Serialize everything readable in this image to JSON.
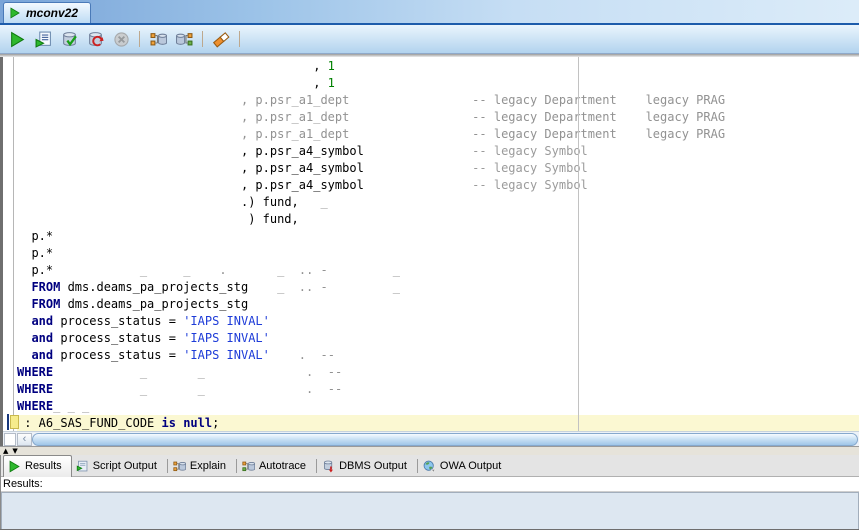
{
  "doc_tab": {
    "label": "mconv22",
    "icon": "run-icon"
  },
  "toolbar": {
    "items": [
      {
        "name": "run-button",
        "icon": "run-icon"
      },
      {
        "name": "run-script-button",
        "icon": "run-script-icon"
      },
      {
        "name": "commit-button",
        "icon": "commit-icon"
      },
      {
        "name": "rollback-button",
        "icon": "rollback-icon"
      },
      {
        "name": "cancel-button",
        "icon": "cancel-icon",
        "disabled": true
      },
      {
        "separator": true
      },
      {
        "name": "query-builder-button",
        "icon": "query-builder-icon"
      },
      {
        "name": "explain-plan-button",
        "icon": "explain-plan-icon"
      },
      {
        "separator": true
      },
      {
        "name": "clear-button",
        "icon": "clear-icon"
      },
      {
        "separator": true
      }
    ]
  },
  "editor": {
    "margin_column": 78,
    "lines": [
      {
        "segments": [
          {
            "col": 41,
            "t": ", ",
            "s": "plain"
          },
          {
            "t": "1",
            "s": "num"
          }
        ]
      },
      {
        "segments": [
          {
            "col": 41,
            "t": ", ",
            "s": "plain"
          },
          {
            "t": "1",
            "s": "num"
          }
        ]
      },
      {
        "segments": [
          {
            "col": 31,
            "t": ", p.psr_a1_dept",
            "s": "dim"
          },
          {
            "col": 63,
            "t": "-- legacy Department",
            "s": "dim"
          },
          {
            "col": 87,
            "t": "legacy PRAG",
            "s": "dim"
          }
        ]
      },
      {
        "segments": [
          {
            "col": 31,
            "t": ", p.psr_a1_dept",
            "s": "dim"
          },
          {
            "col": 63,
            "t": "-- legacy Department",
            "s": "dim"
          },
          {
            "col": 87,
            "t": "legacy PRAG",
            "s": "dim"
          }
        ]
      },
      {
        "segments": [
          {
            "col": 31,
            "t": ", p.psr_a1_dept",
            "s": "dim"
          },
          {
            "col": 63,
            "t": "-- legacy Department",
            "s": "dim"
          },
          {
            "col": 87,
            "t": "legacy PRAG",
            "s": "dim"
          }
        ]
      },
      {
        "segments": [
          {
            "col": 31,
            "t": ", p.psr_a4_symbol",
            "s": "plain"
          },
          {
            "col": 63,
            "t": "-- legacy Symbol",
            "s": "cmt"
          }
        ]
      },
      {
        "segments": [
          {
            "col": 31,
            "t": ", p.psr_a4_symbol",
            "s": "plain"
          },
          {
            "col": 63,
            "t": "-- legacy Symbol",
            "s": "cmt"
          }
        ]
      },
      {
        "segments": [
          {
            "col": 31,
            "t": ", p.psr_a4_symbol",
            "s": "plain"
          },
          {
            "col": 63,
            "t": "-- legacy Symbol",
            "s": "cmt"
          }
        ]
      },
      {
        "segments": [
          {
            "col": 31,
            "t": ".) fund,",
            "s": "plain"
          },
          {
            "col": 42,
            "t": "_",
            "s": "dim"
          }
        ]
      },
      {
        "segments": [
          {
            "col": 32,
            "t": ") fund,",
            "s": "plain"
          }
        ]
      },
      {
        "segments": [
          {
            "col": 2,
            "t": "p.*",
            "s": "plain"
          }
        ]
      },
      {
        "segments": [
          {
            "col": 2,
            "t": "p.*",
            "s": "plain"
          }
        ]
      },
      {
        "segments": [
          {
            "col": 2,
            "t": "p.*",
            "s": "plain"
          },
          {
            "col": 17,
            "t": "_",
            "s": "dim"
          },
          {
            "col": 23,
            "t": "_",
            "s": "dim"
          },
          {
            "col": 28,
            "t": ".",
            "s": "dim"
          },
          {
            "col": 36,
            "t": "_",
            "s": "dim"
          },
          {
            "col": 39,
            "t": ".. -",
            "s": "dim"
          },
          {
            "col": 52,
            "t": "_",
            "s": "dim"
          }
        ]
      },
      {
        "segments": [
          {
            "col": 2,
            "t": "FROM",
            "s": "kw"
          },
          {
            "t": " dms.deams_pa_projects_stg",
            "s": "plain"
          },
          {
            "col": 36,
            "t": "_",
            "s": "dim"
          },
          {
            "col": 39,
            "t": ".. -",
            "s": "dim"
          },
          {
            "col": 52,
            "t": "_",
            "s": "dim"
          }
        ]
      },
      {
        "segments": [
          {
            "col": 2,
            "t": "FROM",
            "s": "kw"
          },
          {
            "t": " dms.deams_pa_projects_stg",
            "s": "plain"
          }
        ]
      },
      {
        "segments": [
          {
            "col": 2,
            "t": "and",
            "s": "kw"
          },
          {
            "t": " process_status = ",
            "s": "plain"
          },
          {
            "t": "'IAPS INVAL'",
            "s": "str"
          }
        ]
      },
      {
        "segments": [
          {
            "col": 2,
            "t": "and",
            "s": "kw"
          },
          {
            "t": " process_status = ",
            "s": "plain"
          },
          {
            "t": "'IAPS INVAL'",
            "s": "str"
          }
        ]
      },
      {
        "segments": [
          {
            "col": 2,
            "t": "and",
            "s": "kw"
          },
          {
            "t": " process_status = ",
            "s": "plain"
          },
          {
            "t": "'IAPS INVAL'",
            "s": "str"
          },
          {
            "col": 39,
            "t": ".",
            "s": "dim"
          },
          {
            "col": 42,
            "t": "--",
            "s": "dim"
          }
        ]
      },
      {
        "segments": [
          {
            "t": "WHERE",
            "s": "kw"
          },
          {
            "col": 17,
            "t": "_",
            "s": "dim"
          },
          {
            "col": 25,
            "t": "_",
            "s": "dim"
          },
          {
            "col": 40,
            "t": ".",
            "s": "dim"
          },
          {
            "col": 43,
            "t": "--",
            "s": "dim"
          }
        ]
      },
      {
        "segments": [
          {
            "t": "WHERE",
            "s": "kw"
          },
          {
            "col": 17,
            "t": "_",
            "s": "dim"
          },
          {
            "col": 25,
            "t": "_",
            "s": "dim"
          },
          {
            "col": 40,
            "t": ".",
            "s": "dim"
          },
          {
            "col": 43,
            "t": "--",
            "s": "dim"
          }
        ]
      },
      {
        "segments": [
          {
            "t": "WHERE",
            "s": "kw"
          },
          {
            "t": "_ _ _",
            "s": "dim"
          }
        ]
      },
      {
        "current": true,
        "segments": [
          {
            "col": 1,
            "t": ": A6_SAS_FUND_CODE ",
            "s": "plain"
          },
          {
            "t": "is null",
            "s": "kw"
          },
          {
            "t": ";",
            "s": "plain"
          }
        ]
      }
    ]
  },
  "hscroll": {
    "left_arrow_glyph": "‹"
  },
  "splitter": {
    "up_glyph": "▲",
    "down_glyph": "▼"
  },
  "bottom_tabs": {
    "tabs": [
      {
        "label": "Results",
        "icon": "results-icon",
        "selected": true
      },
      {
        "label": "Script Output",
        "icon": "script-output-icon",
        "selected": false
      },
      {
        "label": "Explain",
        "icon": "explain-icon",
        "selected": false
      },
      {
        "label": "Autotrace",
        "icon": "autotrace-icon",
        "selected": false
      },
      {
        "label": "DBMS Output",
        "icon": "dbms-output-icon",
        "selected": false
      },
      {
        "label": "OWA Output",
        "icon": "owa-output-icon",
        "selected": false
      }
    ]
  },
  "results": {
    "label": "Results:"
  },
  "colors": {
    "keyword": "#000080",
    "string": "#1e3cd8",
    "number": "#008000",
    "comment": "#9b9b9b",
    "current_line_highlight": "#fbf8d2",
    "tab_strip_blue": "#79a4d8",
    "accent_line": "#1d5cab"
  }
}
